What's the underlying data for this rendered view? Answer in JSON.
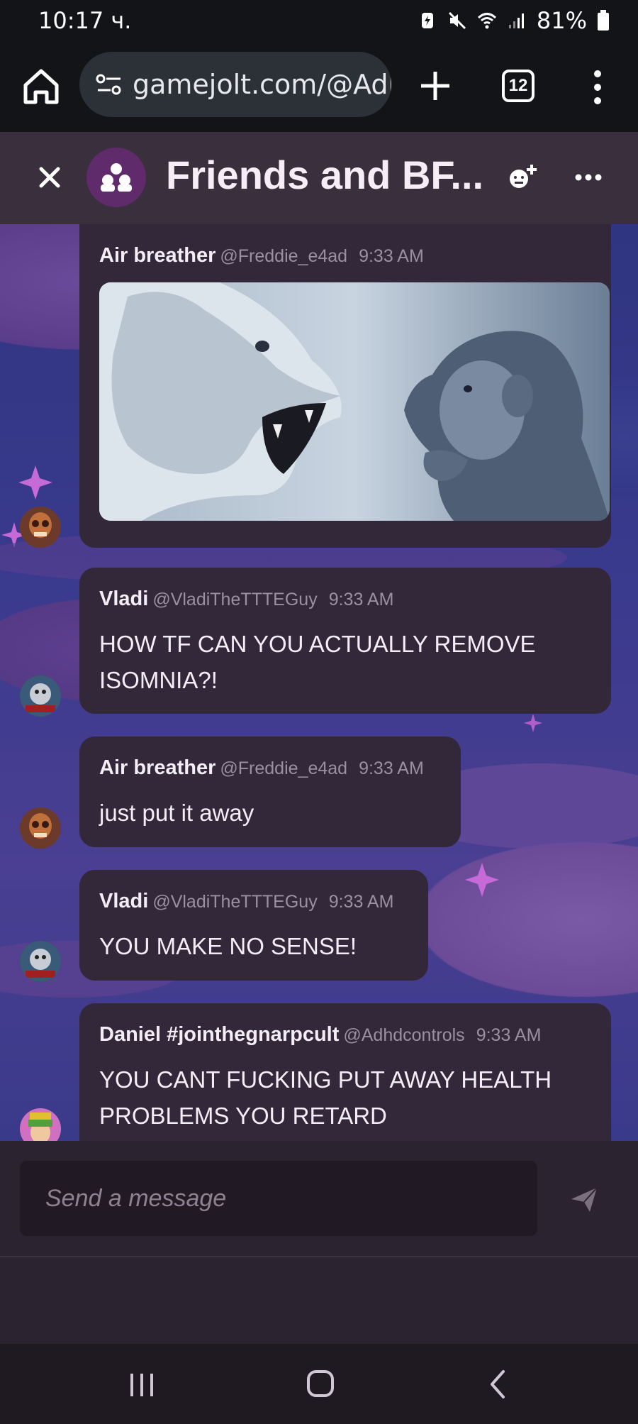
{
  "status": {
    "time": "10:17 ч.",
    "battery": "81%"
  },
  "browser": {
    "url": "gamejolt.com/@Adhd",
    "tab_count": "12"
  },
  "chat": {
    "title": "Friends and BF..."
  },
  "messages": [
    {
      "name": "Air breather",
      "handle": "@Freddie_e4ad",
      "time": "9:33 AM",
      "has_image": true
    },
    {
      "name": "Vladi",
      "handle": "@VladiTheTTTEGuy",
      "time": "9:33 AM",
      "text": "HOW TF CAN YOU ACTUALLY REMOVE ISOMNIA?!"
    },
    {
      "name": "Air breather",
      "handle": "@Freddie_e4ad",
      "time": "9:33 AM",
      "text": "just put it away"
    },
    {
      "name": "Vladi",
      "handle": "@VladiTheTTTEGuy",
      "time": "9:33 AM",
      "text": "YOU MAKE NO SENSE!"
    },
    {
      "name": "Daniel #jointhegnarpcult",
      "handle": "@Adhdcontrols",
      "time": "9:33 AM",
      "text": "YOU CANT FUCKING PUT AWAY HEALTH PROBLEMS YOU RETARD"
    }
  ],
  "composer": {
    "placeholder": "Send a message"
  },
  "colors": {
    "bubble": "#33283a",
    "header": "#3a2f3d",
    "group_icon": "#5f2b6b"
  }
}
